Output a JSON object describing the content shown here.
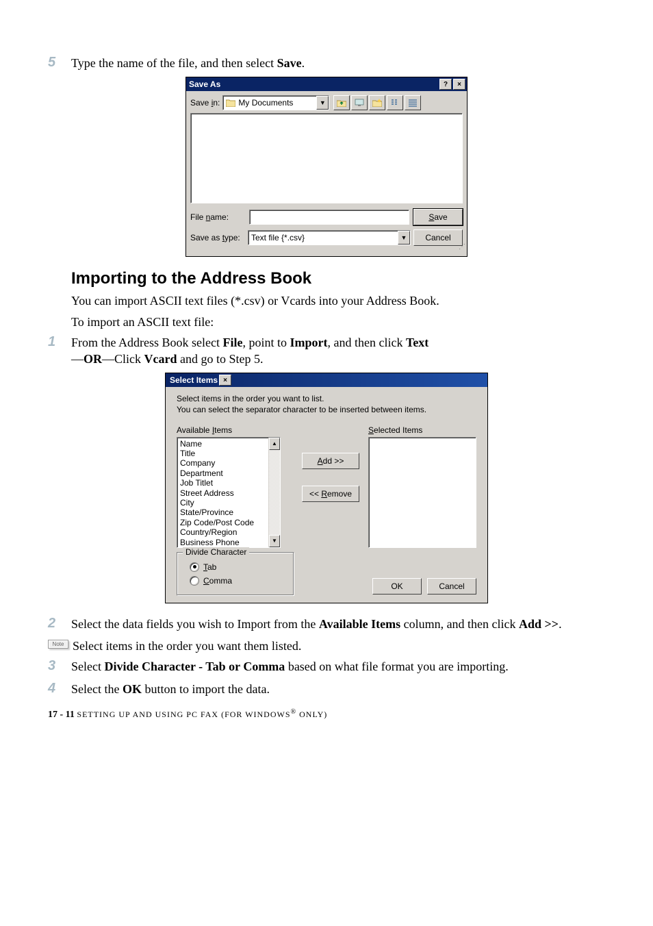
{
  "step5": {
    "num": "5",
    "text_a": "Type the name of the file, and then select ",
    "text_b": "Save",
    "text_c": "."
  },
  "saveAs": {
    "title": "Save As",
    "saveIn_prefix": "Save ",
    "saveIn_u": "i",
    "saveIn_suffix": "n:",
    "folder": "My Documents",
    "fileName_prefix1": "File ",
    "fileName_u": "n",
    "fileName_prefix2": "ame:",
    "fileName_value": "",
    "saveType_prefix1": "Save as ",
    "saveType_u": "t",
    "saveType_prefix2": "ype:",
    "saveType_value": "Text file {*.csv}",
    "btnSave_u": "S",
    "btnSave_rest": "ave",
    "btnCancel": "Cancel",
    "help": "?",
    "close": "×"
  },
  "heading": "Importing to the Address Book",
  "para1": "You can import ASCII text files (*.csv) or Vcards into your Address Book.",
  "para2": "To import an ASCII text file:",
  "step1": {
    "num": "1",
    "a": "From the Address Book select ",
    "b": "File",
    "c": ", point to ",
    "d": "Import",
    "e": ", and then click ",
    "f": "Text",
    "g": " —",
    "h": "OR",
    "i": "—Click ",
    "j": "Vcard",
    "k": " and go to Step 5."
  },
  "selectItems": {
    "title": "Select Items",
    "close": "×",
    "instr1": "Select items in the order you want to list.",
    "instr2": "You can select the separator character to be inserted between items.",
    "availHdr_a": "Available ",
    "availHdr_u": "I",
    "availHdr_b": "tems",
    "selHdr_u": "S",
    "selHdr_b": "elected Items",
    "items": [
      "Name",
      "Title",
      "Company",
      "Department",
      "Job Titlet",
      "Street Address",
      "City",
      "State/Province",
      "Zip Code/Post Code",
      "Country/Region",
      "Business Phone"
    ],
    "add_u": "A",
    "add_rest": "dd >>",
    "remove_prefix": "<< ",
    "remove_u": "R",
    "remove_rest": "emove",
    "groupLegend": "Divide Character",
    "tab_u": "T",
    "tab_rest": "ab",
    "comma_u": "C",
    "comma_rest": "omma",
    "ok": "OK",
    "cancel": "Cancel"
  },
  "step2": {
    "num": "2",
    "a": "Select the data fields you wish to Import from the ",
    "b": "Available Items",
    "c": " column, and then click ",
    "d": "Add >>",
    "e": "."
  },
  "note": {
    "label": "Note",
    "text": "Select items in the order you want them listed."
  },
  "step3": {
    "num": "3",
    "a": "Select ",
    "b": "Divide Character - Tab or Comma",
    "c": " based on what file format you are importing."
  },
  "step4": {
    "num": "4",
    "a": "Select the ",
    "b": "OK",
    "c": " button to import the data."
  },
  "footer": {
    "page": "17 - 11",
    "sp": "   ",
    "chapter_a": "SETTING UP AND USING PC FAX (FOR WINDOWS",
    "reg": "®",
    "chapter_b": " ONLY)"
  }
}
